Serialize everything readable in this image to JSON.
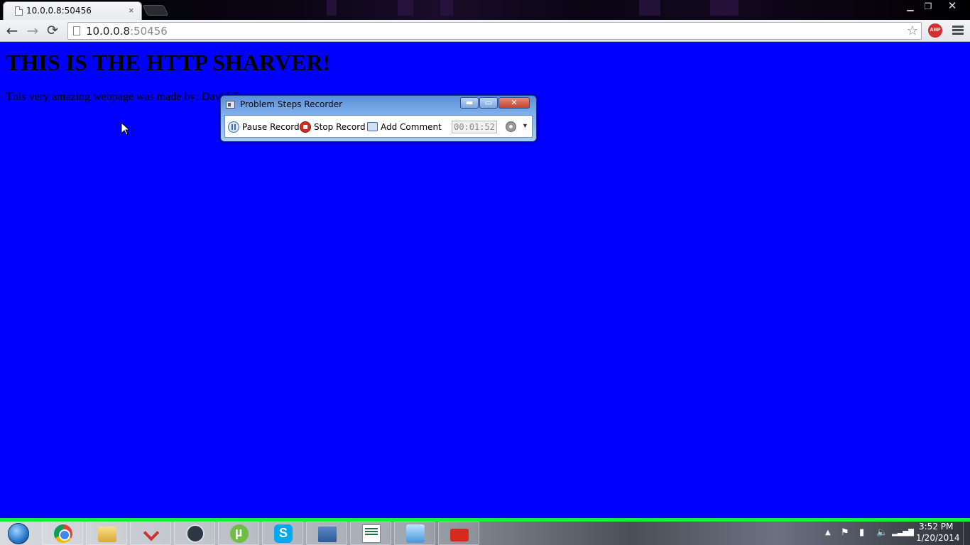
{
  "browser": {
    "tab_title": "10.0.0.8:50456",
    "tab_close": "×",
    "url_host": "10.0.0.8",
    "url_port": ":50456",
    "back": "←",
    "forward": "→",
    "reload": "⟳",
    "star": "☆",
    "abp_label": "ABP",
    "window_minimize": "▁",
    "window_restore": "❐",
    "window_close": "✕"
  },
  "page": {
    "heading": "THIS IS THE HTTP SHARVER!",
    "text": "This very amazing webpage was made by: David T",
    "background_color": "#0000ff"
  },
  "recorder": {
    "title": "Problem Steps Recorder",
    "pause_label": "Pause Record",
    "stop_label": "Stop Record",
    "comment_label": "Add Comment",
    "timer": "00:01:52",
    "minimize": "▬",
    "maximize": "▭",
    "close": "✕",
    "dropdown": "▼"
  },
  "taskbar": {
    "accent_color": "#19ef3a",
    "items": [
      "chrome-icon",
      "explorer-icon",
      "snipping-tool-icon",
      "steam-icon",
      "utorrent-icon",
      "skype-icon",
      "network-icon",
      "document-icon",
      "control-panel-icon",
      "toolbox-icon"
    ],
    "tray": {
      "show_hidden": "▲",
      "flag": "⚑",
      "power": "▮",
      "volume": "🔈",
      "signal": "▂▃▅▇"
    },
    "time": "3:52 PM",
    "date": "1/20/2014"
  }
}
